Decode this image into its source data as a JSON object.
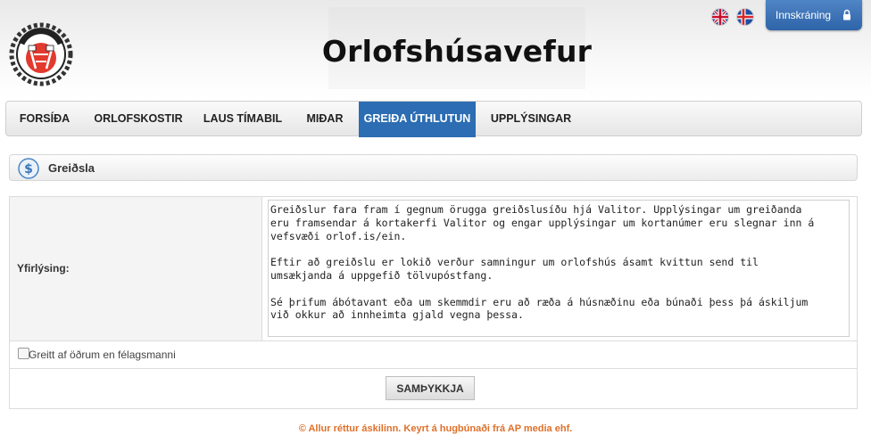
{
  "header": {
    "site_title": "Orlofshúsavefur",
    "logo_text": "EINING-IÐJA",
    "login_label": "Innskráning"
  },
  "languages": [
    {
      "name": "English",
      "icon": "uk-flag-icon"
    },
    {
      "name": "Íslenska",
      "icon": "iceland-flag-icon"
    }
  ],
  "nav": {
    "items": [
      {
        "label": "FORSÍÐA"
      },
      {
        "label": "ORLOFSKOSTIR"
      },
      {
        "label": "LAUS TÍMABIL"
      },
      {
        "label": "MIÐAR"
      },
      {
        "label": "GREIÐA ÚTHLUTUN"
      },
      {
        "label": "UPPLÝSINGAR"
      }
    ],
    "active": "GREIÐA ÚTHLUTUN"
  },
  "section": {
    "title": "Greiðsla",
    "icon": "dollar-icon"
  },
  "form": {
    "declaration_label": "Yfirlýsing:",
    "declaration_text": "Greiðslur fara fram í gegnum örugga greiðslusíðu hjá Valitor. Upplýsingar um greiðanda\neru framsendar á kortakerfi Valitor og engar upplýsingar um kortanúmer eru slegnar inn á\nvefsvæði orlof.is/ein.\n\nEftir að greiðslu er lokið verður samningur um orlofshús ásamt kvittun send til\numsækjanda á uppgefið tölvupóstfang.\n\nSé þrifum ábótavant eða um skemmdir eru að ræða á húsnæðinu eða búnaði þess þá áskiljum\nvið okkur að innheimta gjald vegna þessa.",
    "checkbox_label": "Greitt af öðrum en félagsmanni",
    "checkbox_checked": false,
    "submit_label": "SAMÞYKKJA"
  },
  "footer": {
    "text": "© Allur réttur áskilinn. Keyrt á hugbúnaði frá AP media ehf."
  },
  "colors": {
    "nav_active": "#2c6db3",
    "login_button": "#3a74b8",
    "footer_text": "#e0702a"
  }
}
